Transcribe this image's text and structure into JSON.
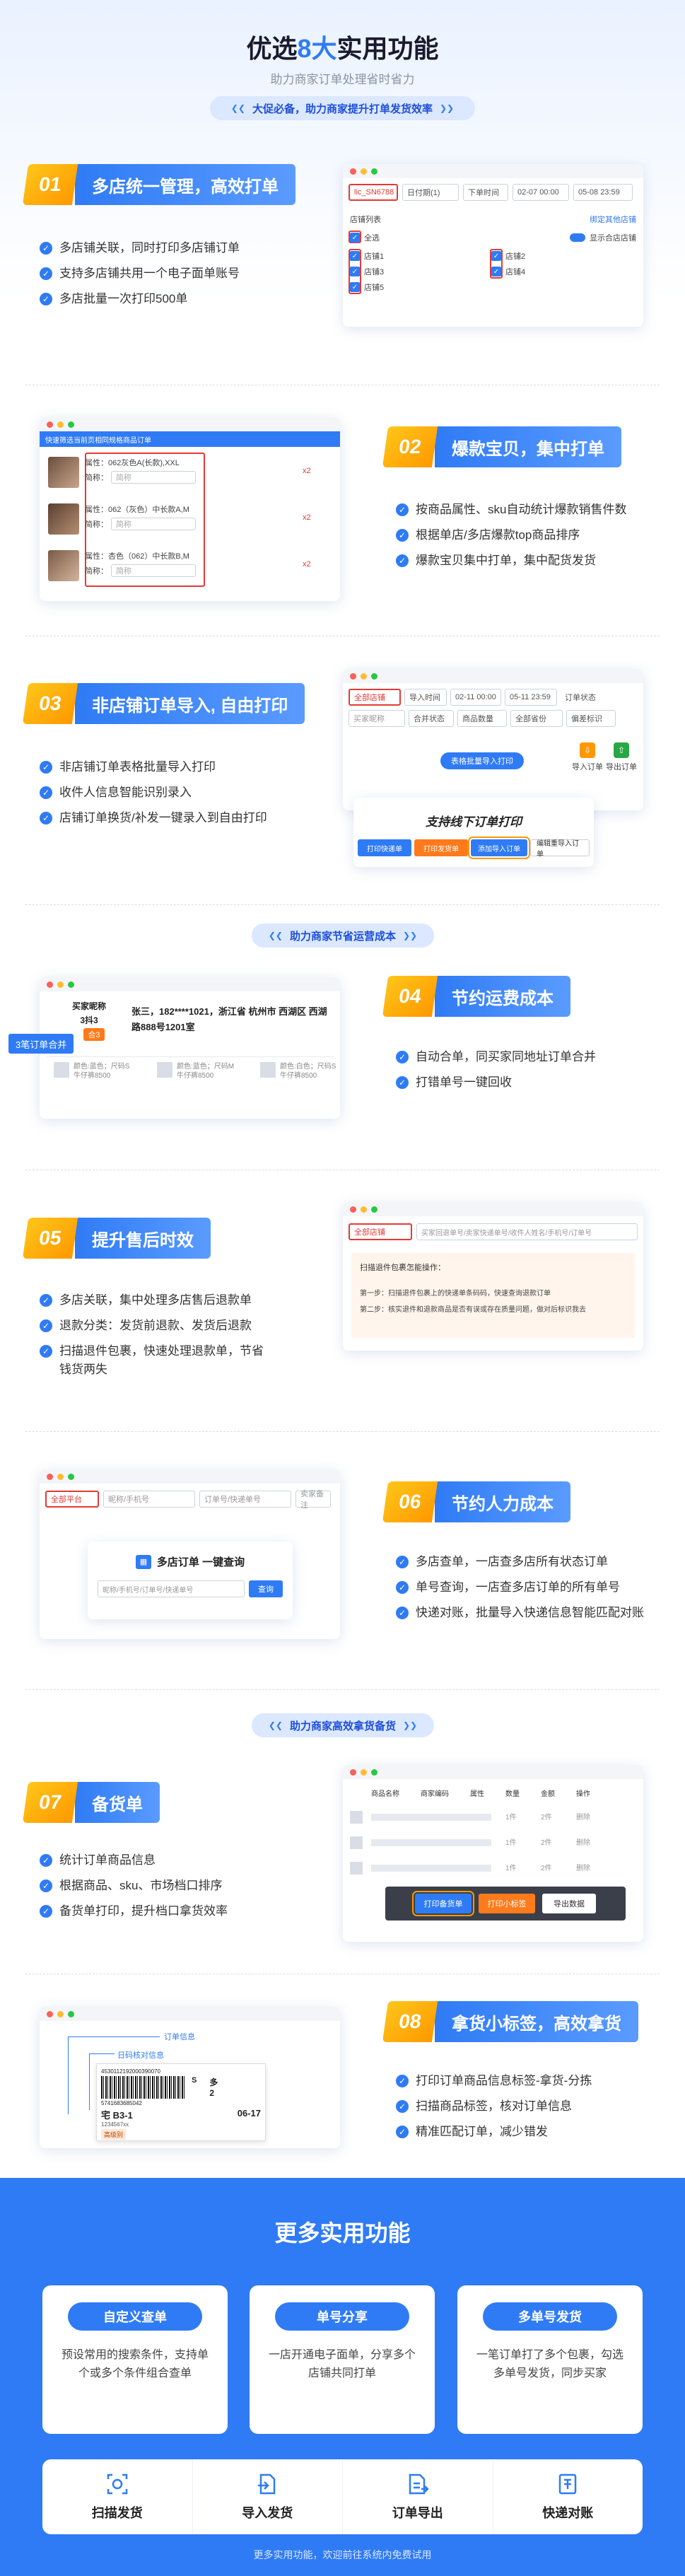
{
  "header": {
    "title_pre": "优选",
    "title_accent": "8大",
    "title_post": "实用功能",
    "subtitle": "助力商家订单处理省时省力",
    "pill": "大促必备，助力商家提升打单发货效率"
  },
  "f1": {
    "num": "01",
    "label": "多店统一管理，高效打单",
    "items": [
      "多店铺关联，同时打印多店铺订单",
      "支持多店铺共用一个电子面单账号",
      "多店批量一次打印500单"
    ],
    "ui": {
      "shop_id": "lic_SN6788",
      "date_type": "日付期(1)",
      "order_time": "下单时间",
      "start": "02-07 00:00",
      "end": "05-08 23:59",
      "list_title": "店铺列表",
      "bind": "绑定其他店铺",
      "all": "全选",
      "show_combined": "显示合店店铺",
      "shops_left": [
        "店铺1",
        "店铺3",
        "店铺5"
      ],
      "shops_right": [
        "店铺2",
        "店铺4"
      ]
    }
  },
  "f2": {
    "num": "02",
    "label": "爆款宝贝，集中打单",
    "items": [
      "按商品属性、sku自动统计爆款销售件数",
      "根据单店/多店爆款top商品排序",
      "爆款宝贝集中打单，集中配货发货"
    ],
    "ui": {
      "banner": "快速筛选当前页相同规格商品订单",
      "attr_label": "属性：",
      "alias_label": "简称：",
      "alias_ph": "简称",
      "rows": [
        {
          "attr": "062灰色A(长款),XXL",
          "qty": "x2"
        },
        {
          "attr": "062（灰色）中长款A,M",
          "qty": "x2"
        },
        {
          "attr": "杏色（062）中长款B,M",
          "qty": "x2"
        }
      ]
    }
  },
  "f3": {
    "num": "03",
    "label": "非店铺订单导入, 自由打印",
    "items": [
      "非店铺订单表格批量导入打印",
      "收件人信息智能识别录入",
      "店铺订单换货/补发一键录入到自由打印"
    ],
    "ui": {
      "shop": "全部店铺",
      "import_time": "导入时间",
      "start": "02-11 00:00",
      "end": "05-11 23:59",
      "status": "订单状态",
      "filter": [
        "买家昵称",
        "合并状态",
        "商品数量",
        "全部省份",
        "偏差标识"
      ],
      "batch": "表格批量导入打印",
      "import_order": "导入订单",
      "export_order": "导出订单",
      "support": "支持线下订单打印",
      "btns": [
        "打印快递单",
        "打印发货单",
        "添加导入订单",
        "编辑重导入订单"
      ]
    }
  },
  "pill2": "助力商家节省运营成本",
  "f4": {
    "num": "04",
    "label": "节约运费成本",
    "items": [
      "自动合单，同买家同地址订单合并",
      "打错单号一键回收"
    ],
    "ui": {
      "merge_tag": "3笔订单合并",
      "buyer": "买家昵称",
      "count": "3抖3",
      "merge": "合3",
      "address": "张三，182****1021，浙江省 杭州市 西湖区 西湖路888号1201室",
      "products": [
        "颜色:蓝色；尺码S 牛仔裤8500",
        "颜色:蓝色；尺码M 牛仔裤8500",
        "颜色:白色；尺码S 牛仔裤8500"
      ]
    }
  },
  "f5": {
    "num": "05",
    "label": "提升售后时效",
    "items": [
      "多店关联，集中处理多店售后退款单",
      "退款分类：发货前退款、发货后退款",
      "扫描退件包裹，快速处理退款单，节省钱货两失"
    ],
    "ui": {
      "shop": "全部店铺",
      "search_ph": "买家回退单号/卖家快递单号/收件人姓名/手机号/订单号",
      "tip_title": "扫描退件包裹怎能操作：",
      "step1": "第一步：扫描退件包裹上的快递单条码码，快速查询退款订单",
      "step2": "第二步：核实退件和退款商品是否有误或存在质量问题，做对后标识我去"
    }
  },
  "f6": {
    "num": "06",
    "label": "节约人力成本",
    "items": [
      "多店查单，一店查多店所有状态订单",
      "单号查询，一店查多店订单的所有单号",
      "快递对账，批量导入快递信息智能匹配对账"
    ],
    "ui": {
      "shop": "全部平台",
      "search1": "昵称/手机号",
      "search2": "订单号/快递单号",
      "search3": "卖家备注",
      "query_title": "多店订单 一键查询",
      "query_ph": "昵称/手机号/订单号/快递单号",
      "query_btn": "查询"
    }
  },
  "pill3": "助力商家高效拿货备货",
  "f7": {
    "num": "07",
    "label": "备货单",
    "items": [
      "统计订单商品信息",
      "根据商品、sku、市场档口排序",
      "备货单打印，提升档口拿货效率"
    ],
    "ui": {
      "cols": [
        "商品名称",
        "商家编码",
        "属性",
        "数量",
        "金额",
        "操作"
      ],
      "rows": [
        {
          "qty": "1件",
          "amt": "2件",
          "op": "删除"
        },
        {
          "qty": "1件",
          "amt": "2件",
          "op": "删除"
        },
        {
          "qty": "1件",
          "amt": "2件",
          "op": "删除"
        }
      ],
      "btns": [
        "打印备货单",
        "打印小标签",
        "导出数据"
      ]
    }
  },
  "f8": {
    "num": "08",
    "label": "拿货小标签，高效拿货",
    "items": [
      "打印订单商品信息标签-拿货-分拣",
      "扫描商品标签，核对订单信息",
      "精准匹配订单，减少错发"
    ],
    "ui": {
      "order_info": "订单信息",
      "day_info": "日码核对信息",
      "barcode_num": "4530112192000390070",
      "s_label": "S",
      "duo": "多",
      "count": "2",
      "barcode2": "5741683685042",
      "code": "宅 B3-1",
      "date": "06-17",
      "short": "1234567xx",
      "tag": "高级别"
    }
  },
  "more": {
    "title": "更多实用功能",
    "cards": [
      {
        "title": "自定义查单",
        "desc": "预设常用的搜索条件，支持单个或多个条件组合查单"
      },
      {
        "title": "单号分享",
        "desc": "一店开通电子面单，分享多个店铺共同打单"
      },
      {
        "title": "多单号发货",
        "desc": "一笔订单打了多个包裹，勾选多单号发货，同步买家"
      }
    ],
    "icons": [
      {
        "name": "scan-icon",
        "label": "扫描发货"
      },
      {
        "name": "import-icon",
        "label": "导入发货"
      },
      {
        "name": "export-icon",
        "label": "订单导出"
      },
      {
        "name": "reconcile-icon",
        "label": "快递对账"
      }
    ],
    "footer": "更多实用功能，欢迎前往系统内免费试用"
  }
}
